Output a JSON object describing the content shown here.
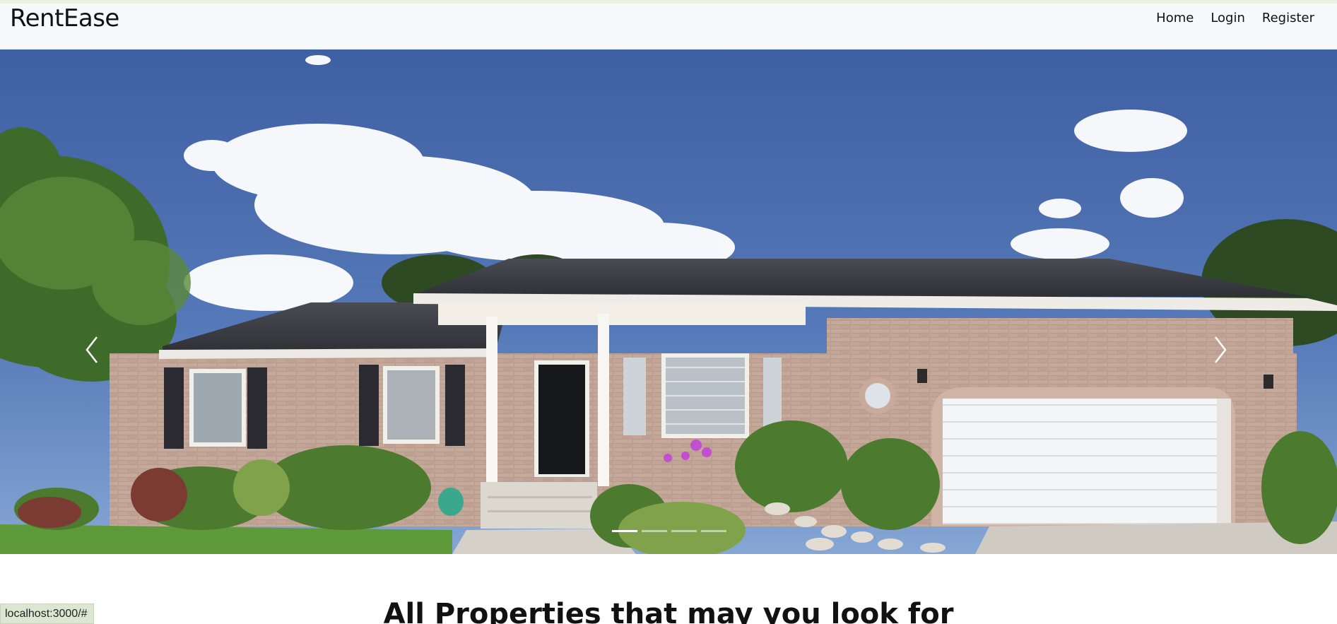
{
  "app": {
    "brand": "RentEase"
  },
  "nav": {
    "items": [
      {
        "label": "Home"
      },
      {
        "label": "Login"
      },
      {
        "label": "Register"
      }
    ]
  },
  "carousel": {
    "slide_count": 4,
    "active_index": 0,
    "prev_icon": "chevron-left-icon",
    "next_icon": "chevron-right-icon",
    "image": "suburban brick house with white garage door under blue sky"
  },
  "main": {
    "section_title": "All Properties that may you look for"
  },
  "status_bar": {
    "url": "localhost:3000/#"
  },
  "colors": {
    "sky": "#4f73b0",
    "navbar": "#f8f9fb",
    "status_bg": "#dbe6d3"
  }
}
